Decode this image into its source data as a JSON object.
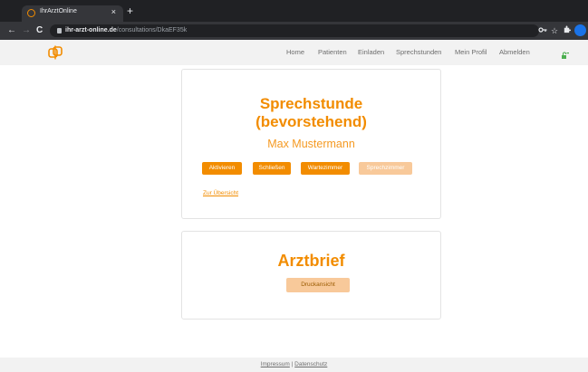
{
  "browser": {
    "tab_title": "IhrArztOnline",
    "tab_close": "×",
    "new_tab": "+",
    "back": "←",
    "forward": "→",
    "reload": "C",
    "url_host": "ihr-arzt-online.de",
    "url_path": "/consultations/DkaEF35k"
  },
  "nav": {
    "items": [
      "Home",
      "Patienten",
      "Einladen",
      "Sprechstunden",
      "Mein Profil",
      "Abmelden"
    ],
    "logo_icon": "ihrarztonline-logo-icon",
    "key_icon": "key-icon"
  },
  "consultation": {
    "title_line1": "Sprechstunde",
    "title_line2": "(bevorstehend)",
    "patient_name": "Max Mustermann",
    "buttons": {
      "activate": "Aktivieren",
      "close": "Schließen",
      "waiting_room": "Wartezimmer",
      "consultation_room": "Sprechzimmer"
    },
    "overview_link": "Zur Übersicht"
  },
  "doctor_letter": {
    "title": "Arztbrief",
    "print_button": "Druckansicht"
  },
  "footer": {
    "impressum": "Impressum",
    "separator": "|",
    "datenschutz": "Datenschutz"
  },
  "colors": {
    "accent": "#f28c00",
    "accent_disabled": "#f8c99a"
  }
}
